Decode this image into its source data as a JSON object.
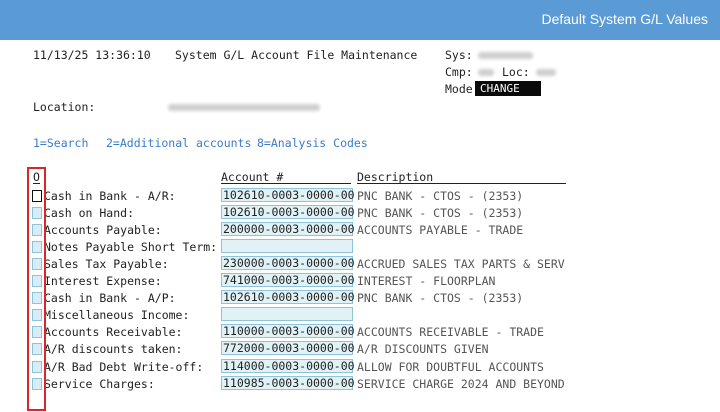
{
  "window": {
    "title": "Default System G/L Values"
  },
  "header": {
    "datetime": "11/13/25 13:36:10",
    "screen_title": "System G/L Account File Maintenance",
    "sys_label": "Sys:",
    "cmp_label": "Cmp:",
    "loc_label": "Loc:",
    "mode_label": "Mode",
    "mode_value": "CHANGE",
    "location_label": "Location:"
  },
  "function_keys": [
    {
      "label": "1=Search"
    },
    {
      "label": "2=Additional accounts"
    },
    {
      "label": "8=Analysis Codes"
    }
  ],
  "table": {
    "col_option": "O",
    "col_account": "Account #",
    "col_description": "Description",
    "rows": [
      {
        "label": "Cash in Bank - A/R:",
        "account": "102610-0003-0000-00",
        "description": "PNC BANK - CTOS - (2353)"
      },
      {
        "label": "Cash on Hand:",
        "account": "102610-0003-0000-00",
        "description": "PNC BANK - CTOS - (2353)"
      },
      {
        "label": "Accounts Payable:",
        "account": "200000-0003-0000-00",
        "description": "ACCOUNTS PAYABLE - TRADE"
      },
      {
        "label": "Notes Payable Short Term:",
        "account": "",
        "description": ""
      },
      {
        "label": "Sales Tax Payable:",
        "account": "230000-0003-0000-00",
        "description": "ACCRUED SALES TAX PARTS & SERV"
      },
      {
        "label": "Interest Expense:",
        "account": "741000-0003-0000-00",
        "description": "INTEREST - FLOORPLAN"
      },
      {
        "label": "Cash in Bank - A/P:",
        "account": "102610-0003-0000-00",
        "description": "PNC BANK - CTOS - (2353)"
      },
      {
        "label": "Miscellaneous Income:",
        "account": "",
        "description": ""
      },
      {
        "label": "Accounts Receivable:",
        "account": "110000-0003-0000-00",
        "description": "ACCOUNTS RECEIVABLE - TRADE"
      },
      {
        "label": "A/R discounts taken:",
        "account": "772000-0003-0000-00",
        "description": "A/R DISCOUNTS GIVEN"
      },
      {
        "label": "A/R Bad Debt Write-off:",
        "account": "114000-0003-0000-00",
        "description": "ALLOW FOR DOUBTFUL ACCOUNTS"
      },
      {
        "label": "Service Charges:",
        "account": "110985-0003-0000-00",
        "description": "SERVICE CHARGE 2024 AND BEYOND"
      }
    ]
  },
  "colors": {
    "titlebar": "#5b9bd5",
    "field_bg": "#e1f2f7",
    "field_border": "#8fc3da",
    "function_key": "#3a7cc7",
    "highlight_box": "#d62828"
  }
}
